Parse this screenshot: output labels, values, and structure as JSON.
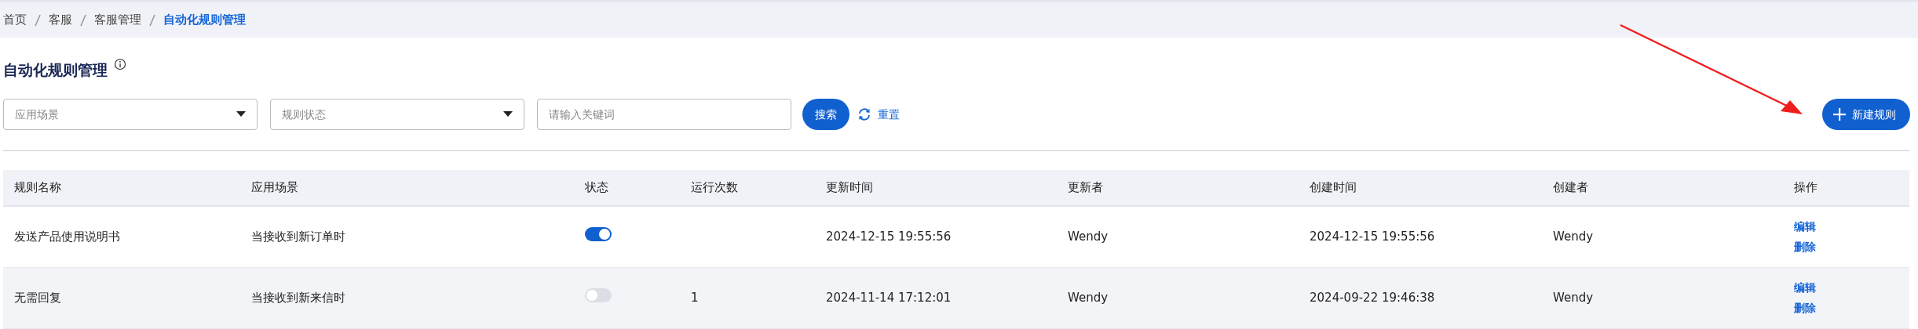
{
  "breadcrumb": [
    {
      "label": "首页",
      "selected": false
    },
    {
      "label": "客服",
      "selected": false
    },
    {
      "label": "客服管理",
      "selected": false
    },
    {
      "label": "自动化规则管理",
      "selected": true
    }
  ],
  "page_title": "自动化规则管理",
  "filters": [
    {
      "kind": "select",
      "placeholder": "应用场景"
    },
    {
      "kind": "select",
      "placeholder": "规则状态"
    },
    {
      "kind": "input",
      "placeholder": "请输入关键词"
    }
  ],
  "search_button": "搜索",
  "reset_button": "重置",
  "new_button": "新建规则",
  "table": {
    "columns": [
      "规则名称",
      "应用场景",
      "状态",
      "运行次数",
      "更新时间",
      "更新者",
      "创建时间",
      "创建者",
      "操作"
    ],
    "rows": [
      {
        "name": "发送产品使用说明书",
        "scenario": "当接收到新订单时",
        "on": true,
        "updated": "2024-12-15 19:55:56",
        "updater": "Wendy",
        "created": "2024-12-15 19:55:56",
        "creator": "Wendy",
        "actions": [
          "编辑",
          "删除"
        ]
      },
      {
        "name": "无需回复",
        "scenario": "当接收到新来信时",
        "on": false,
        "run_count": "1",
        "updated": "2024-11-14 17:12:01",
        "updater": "Wendy",
        "created": "2024-09-22 19:46:38",
        "creator": "Wendy",
        "actions": [
          "编辑",
          "删除"
        ]
      }
    ]
  }
}
